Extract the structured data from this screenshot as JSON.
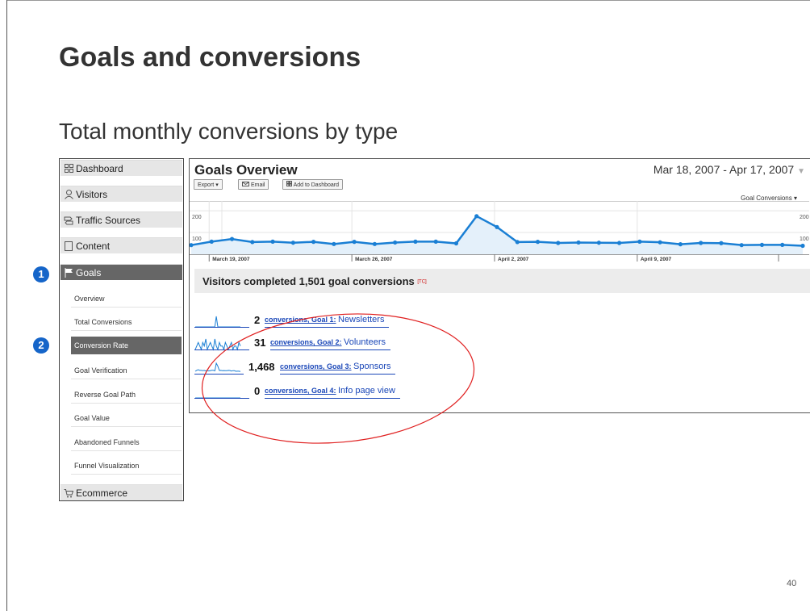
{
  "slide": {
    "title": "Goals and conversions",
    "subtitle": "Total monthly conversions by type",
    "page_number": "40"
  },
  "sidebar": {
    "sections": [
      {
        "label": "Dashboard",
        "icon": "grid-icon"
      },
      {
        "label": "Visitors",
        "icon": "person-icon"
      },
      {
        "label": "Traffic Sources",
        "icon": "signpost-icon"
      },
      {
        "label": "Content",
        "icon": "page-icon"
      },
      {
        "label": "Goals",
        "icon": "flag-icon"
      },
      {
        "label": "Ecommerce",
        "icon": "cart-icon"
      }
    ],
    "goal_items": [
      "Overview",
      "Total Conversions",
      "Conversion Rate",
      "Goal Verification",
      "Reverse Goal Path",
      "Goal Value",
      "Abandoned Funnels",
      "Funnel Visualization"
    ],
    "active_section": "Goals",
    "active_item": "Conversion Rate"
  },
  "markers": [
    "1",
    "2"
  ],
  "panel": {
    "title": "Goals Overview",
    "date_range": "Mar 18, 2007 - Apr 17, 2007",
    "toolbar": {
      "export": "Export",
      "email": "Email",
      "add_to_dashboard": "Add to Dashboard"
    },
    "metric_selector": "Goal Conversions",
    "completed": {
      "text": "Visitors completed 1,501 goal conversions",
      "tag": "[TC]"
    },
    "goals": [
      {
        "count": "2",
        "prefix": "conversions, Goal 1:",
        "name": "Newsletters"
      },
      {
        "count": "31",
        "prefix": "conversions, Goal 2:",
        "name": "Volunteers"
      },
      {
        "count": "1,468",
        "prefix": "conversions, Goal 3:",
        "name": "Sponsors"
      },
      {
        "count": "0",
        "prefix": "conversions, Goal 4:",
        "name": "Info page view"
      }
    ]
  },
  "colors": {
    "line": "#1a7fd4",
    "fill": "#e4f0fa",
    "accent": "#1565c9",
    "highlight": "#e02020",
    "link": "#1a47b8"
  },
  "chart_data": {
    "type": "area",
    "x": [
      "2007-03-18",
      "2007-03-19",
      "2007-03-20",
      "2007-03-21",
      "2007-03-22",
      "2007-03-23",
      "2007-03-24",
      "2007-03-25",
      "2007-03-26",
      "2007-03-27",
      "2007-03-28",
      "2007-03-29",
      "2007-03-30",
      "2007-03-31",
      "2007-04-01",
      "2007-04-02",
      "2007-04-03",
      "2007-04-04",
      "2007-04-05",
      "2007-04-06",
      "2007-04-07",
      "2007-04-08",
      "2007-04-09",
      "2007-04-10",
      "2007-04-11",
      "2007-04-12",
      "2007-04-13",
      "2007-04-14",
      "2007-04-15",
      "2007-04-16",
      "2007-04-17"
    ],
    "values": [
      42,
      58,
      70,
      56,
      58,
      53,
      57,
      47,
      57,
      47,
      54,
      58,
      58,
      50,
      175,
      125,
      56,
      57,
      52,
      54,
      53,
      52,
      58,
      55,
      46,
      52,
      51,
      42,
      43,
      43,
      39
    ],
    "x_tick_labels": [
      "March 19, 2007",
      "March 26, 2007",
      "April 2, 2007",
      "April 9, 2007"
    ],
    "x_ticks": [
      "2007-03-19",
      "2007-03-26",
      "2007-04-02",
      "2007-04-09"
    ],
    "y_tick_labels": [
      "200",
      "100"
    ],
    "y_ticks": [
      200,
      100
    ],
    "ylim": [
      0,
      230
    ],
    "grid": true,
    "sparklines": [
      [
        0,
        0,
        0,
        0,
        0,
        0,
        0,
        0,
        0,
        0,
        0,
        0,
        0,
        0,
        1,
        0,
        0,
        0,
        0,
        0,
        0,
        0,
        0,
        0,
        0,
        0,
        0,
        0,
        0,
        0,
        0
      ],
      [
        0,
        1,
        2,
        1,
        0,
        2,
        1,
        3,
        0,
        1,
        2,
        1,
        0,
        3,
        1,
        0,
        2,
        1,
        1,
        0,
        2,
        1,
        0,
        1,
        2,
        0,
        1,
        1,
        0,
        2,
        1
      ],
      [
        40,
        56,
        67,
        54,
        55,
        51,
        54,
        45,
        55,
        45,
        51,
        56,
        56,
        47,
        173,
        124,
        53,
        55,
        49,
        52,
        51,
        50,
        55,
        53,
        44,
        50,
        49,
        40,
        41,
        41,
        37
      ],
      [
        0,
        0,
        0,
        0,
        0,
        0,
        0,
        0,
        0,
        0,
        0,
        0,
        0,
        0,
        0,
        0,
        0,
        0,
        0,
        0,
        0,
        0,
        0,
        0,
        0,
        0,
        0,
        0,
        0,
        0,
        0
      ]
    ]
  }
}
